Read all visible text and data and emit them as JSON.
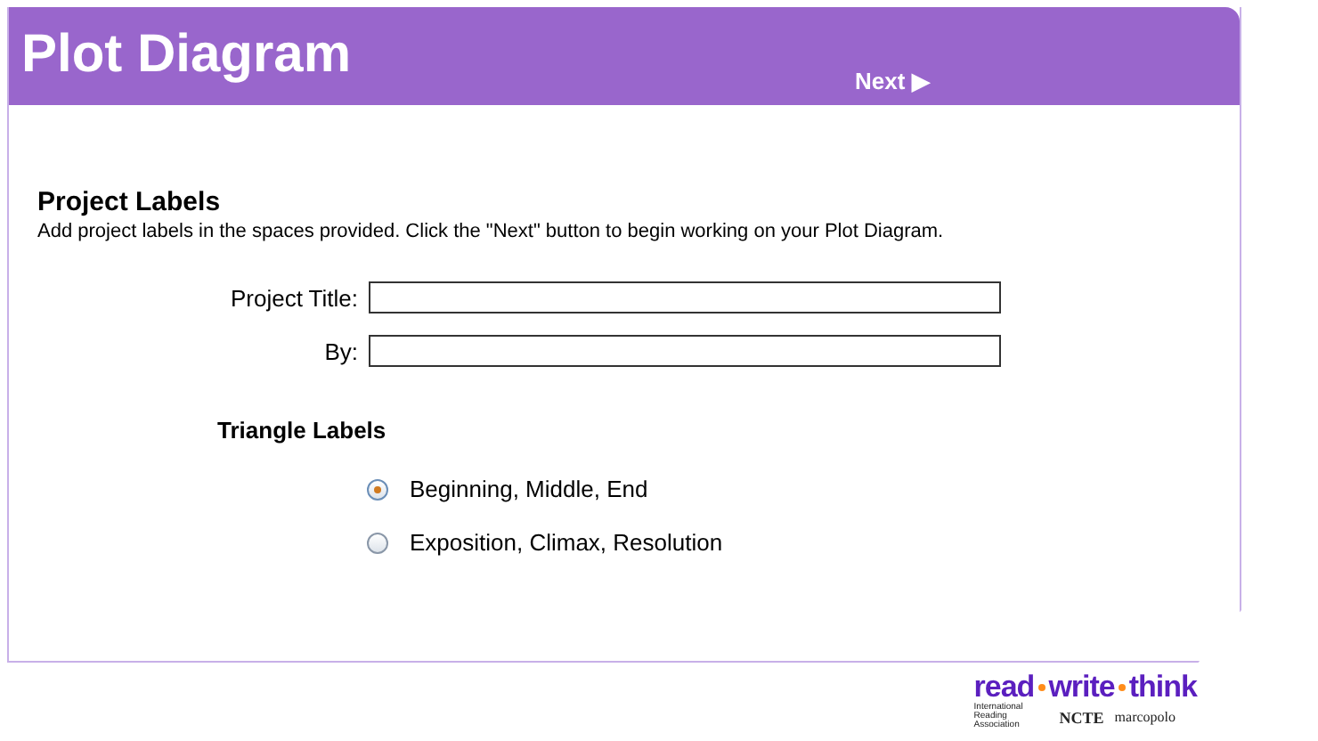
{
  "header": {
    "title": "Plot Diagram",
    "next_button": "Next ▶"
  },
  "section": {
    "heading": "Project Labels",
    "instructions": "Add project labels in the spaces provided. Click the \"Next\" button to begin working on your Plot Diagram."
  },
  "fields": [
    {
      "label": "Project Title:"
    },
    {
      "label": "By:"
    }
  ],
  "triangle_labels": {
    "heading": "Triangle Labels",
    "options": [
      {
        "label": "Beginning, Middle, End",
        "selected": true
      },
      {
        "label": "Exposition, Climax, Resolution",
        "selected": false
      }
    ]
  },
  "logo": {
    "words": [
      "read",
      "write",
      "think"
    ],
    "partners": [
      "International Reading Association",
      "NCTE",
      "marcopolo"
    ]
  }
}
